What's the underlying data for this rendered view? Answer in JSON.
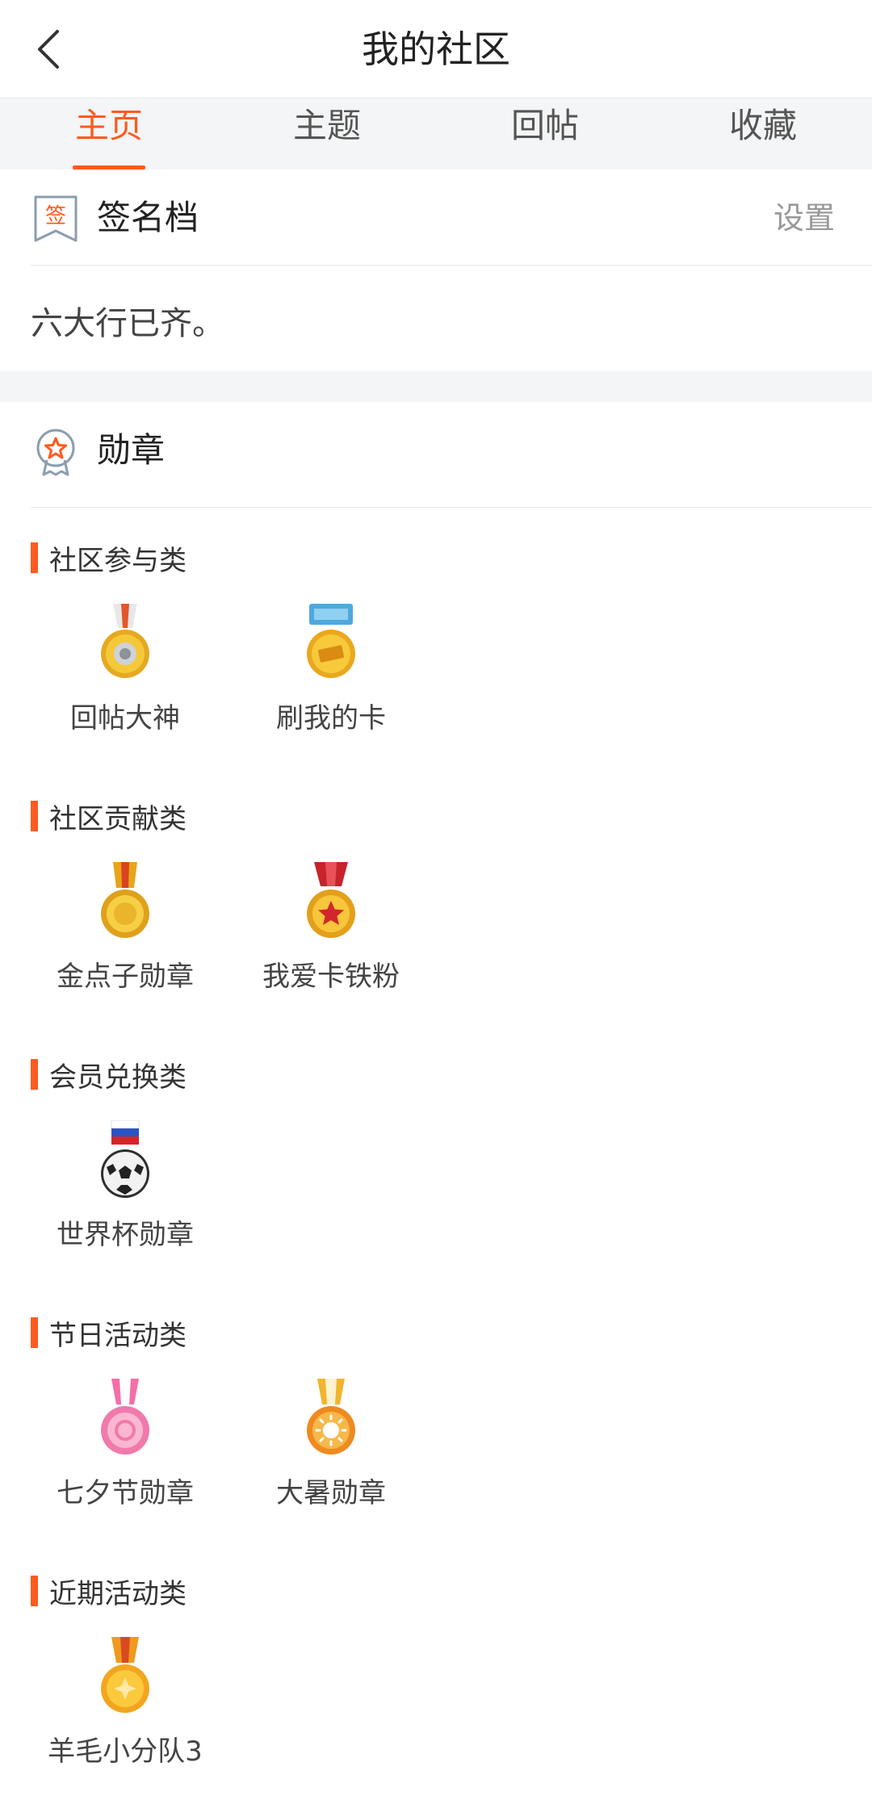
{
  "header": {
    "title": "我的社区",
    "back_icon": "chevron-left-icon"
  },
  "tabs": [
    {
      "label": "主页",
      "active": true
    },
    {
      "label": "主题",
      "active": false
    },
    {
      "label": "回帖",
      "active": false
    },
    {
      "label": "收藏",
      "active": false
    }
  ],
  "signature": {
    "title": "签名档",
    "icon_glyph": "签",
    "action": "设置",
    "text": "六大行已齐。"
  },
  "medals_section": {
    "title": "勋章",
    "categories": [
      {
        "title": "社区参与类",
        "items": [
          {
            "name": "回帖大神"
          },
          {
            "name": "刷我的卡"
          }
        ]
      },
      {
        "title": "社区贡献类",
        "items": [
          {
            "name": "金点子勋章"
          },
          {
            "name": "我爱卡铁粉"
          }
        ]
      },
      {
        "title": "会员兑换类",
        "items": [
          {
            "name": "世界杯勋章"
          }
        ]
      },
      {
        "title": "节日活动类",
        "items": [
          {
            "name": "七夕节勋章"
          },
          {
            "name": "大暑勋章"
          }
        ]
      },
      {
        "title": "近期活动类",
        "items": [
          {
            "name": "羊毛小分队3"
          }
        ]
      }
    ]
  },
  "colors": {
    "accent": "#ff5a1f",
    "gold": "#f2b51f",
    "muted_text": "#999999",
    "gap_bg": "#f4f5f6"
  }
}
